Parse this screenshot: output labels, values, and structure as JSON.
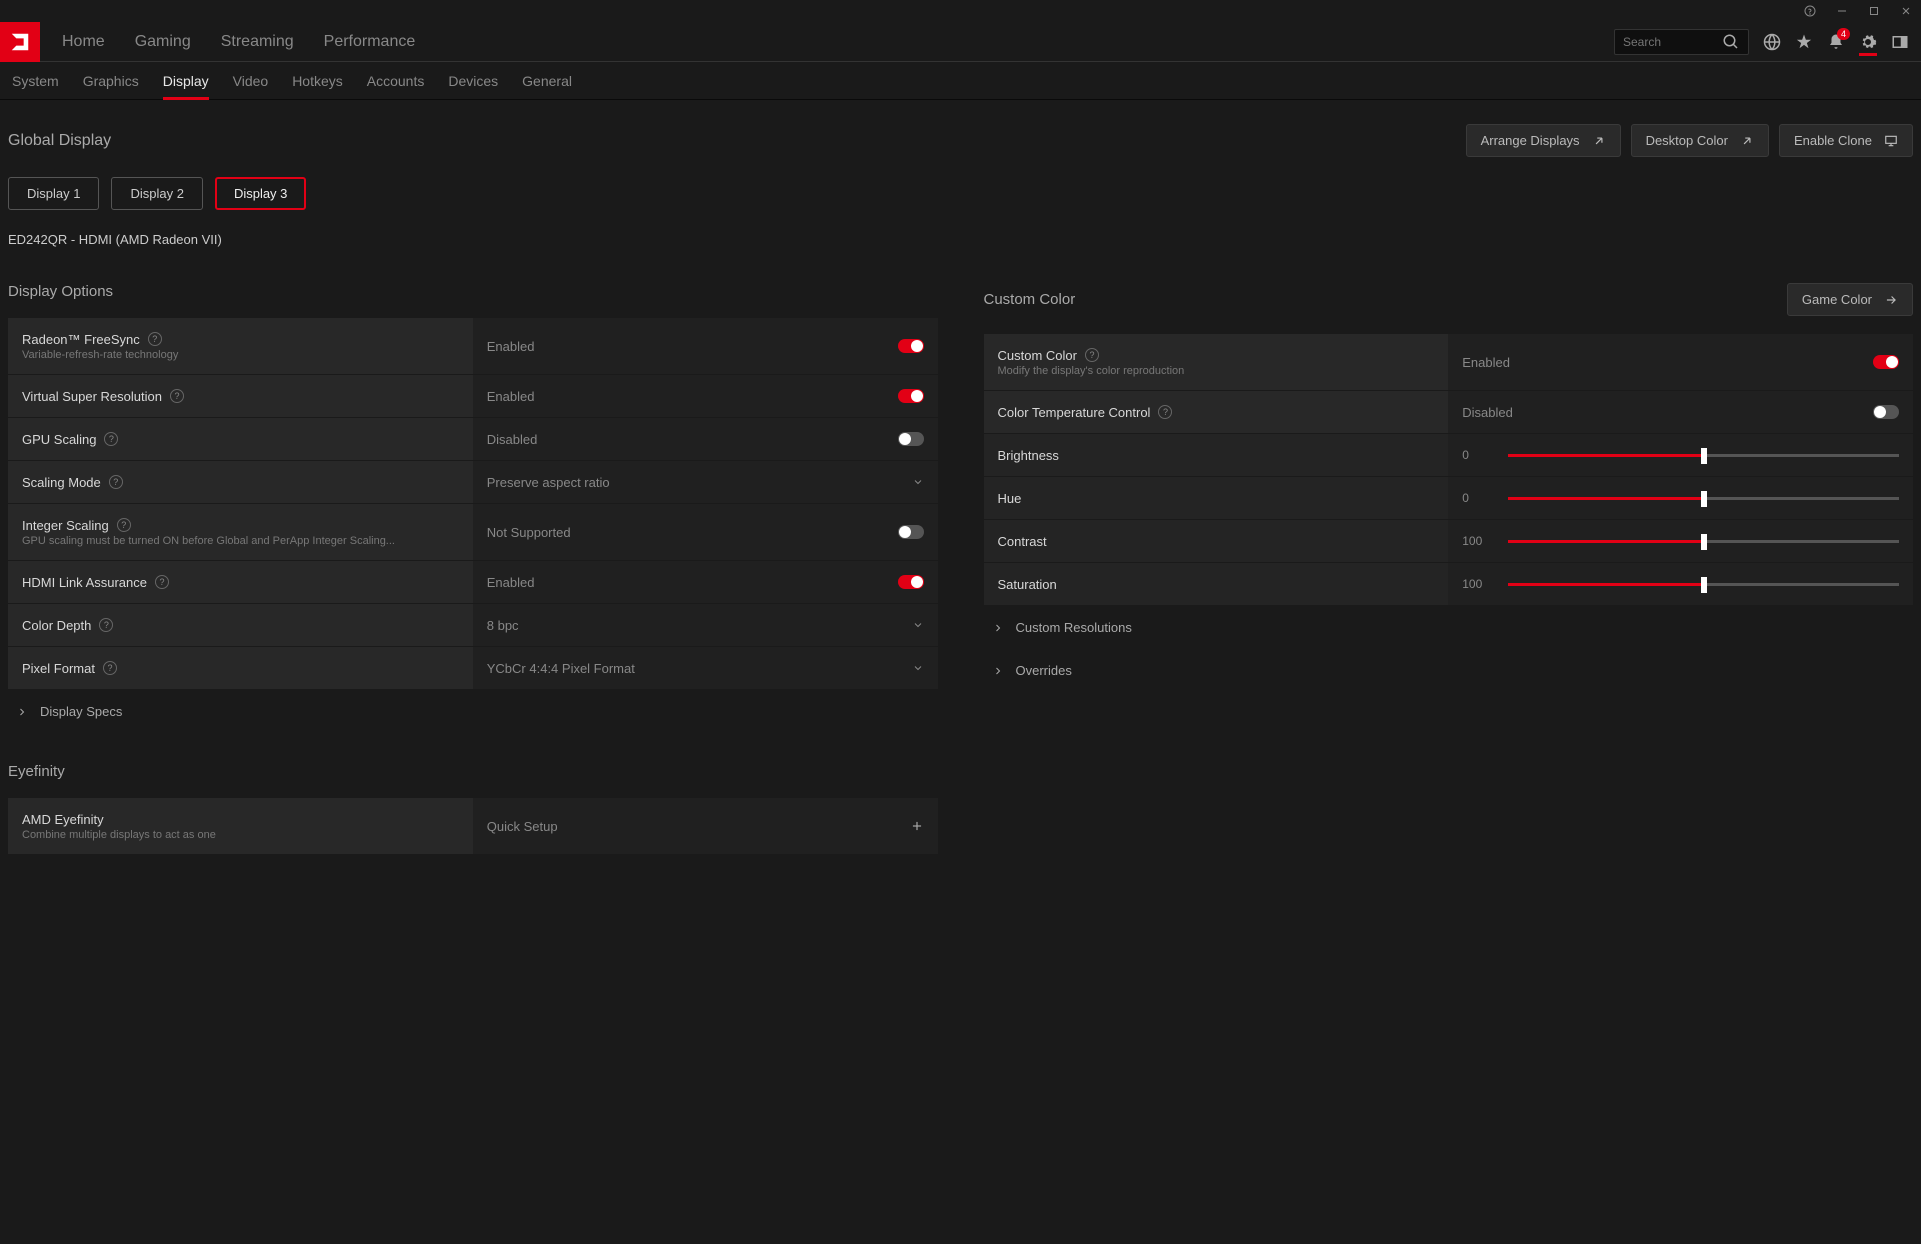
{
  "titlebar": {
    "help": "?",
    "min": "−",
    "max": "□",
    "close": "✕"
  },
  "mainnav": {
    "tabs": [
      "Home",
      "Gaming",
      "Streaming",
      "Performance"
    ],
    "search_placeholder": "Search",
    "notification_count": "4"
  },
  "subnav": {
    "tabs": [
      "System",
      "Graphics",
      "Display",
      "Video",
      "Hotkeys",
      "Accounts",
      "Devices",
      "General"
    ],
    "active": 2
  },
  "page": {
    "title": "Global Display",
    "actions": {
      "arrange": "Arrange Displays",
      "desktop_color": "Desktop Color",
      "enable_clone": "Enable Clone"
    },
    "display_tabs": [
      "Display 1",
      "Display 2",
      "Display 3"
    ],
    "display_active": 2,
    "display_info": "ED242QR - HDMI (AMD Radeon VII)"
  },
  "display_options": {
    "title": "Display Options",
    "freesync": {
      "name": "Radeon™ FreeSync",
      "sub": "Variable-refresh-rate technology",
      "value": "Enabled",
      "on": true
    },
    "vsr": {
      "name": "Virtual Super Resolution",
      "value": "Enabled",
      "on": true
    },
    "gpu_scaling": {
      "name": "GPU Scaling",
      "value": "Disabled",
      "on": false
    },
    "scaling_mode": {
      "name": "Scaling Mode",
      "value": "Preserve aspect ratio"
    },
    "integer_scaling": {
      "name": "Integer Scaling",
      "sub": "GPU scaling must be turned ON before Global and PerApp Integer Scaling...",
      "value": "Not Supported",
      "on": false
    },
    "hdmi_link": {
      "name": "HDMI Link Assurance",
      "value": "Enabled",
      "on": true
    },
    "color_depth": {
      "name": "Color Depth",
      "value": "8 bpc"
    },
    "pixel_format": {
      "name": "Pixel Format",
      "value": "YCbCr 4:4:4 Pixel Format"
    },
    "display_specs": "Display Specs"
  },
  "eyefinity": {
    "title": "Eyefinity",
    "name": "AMD Eyefinity",
    "sub": "Combine multiple displays to act as one",
    "value": "Quick Setup"
  },
  "custom_color": {
    "title": "Custom Color",
    "game_color_btn": "Game Color",
    "custom": {
      "name": "Custom Color",
      "sub": "Modify the display's color reproduction",
      "value": "Enabled",
      "on": true
    },
    "temp": {
      "name": "Color Temperature Control",
      "value": "Disabled",
      "on": false
    },
    "brightness": {
      "name": "Brightness",
      "value": "0",
      "pct": 50
    },
    "hue": {
      "name": "Hue",
      "value": "0",
      "pct": 50
    },
    "contrast": {
      "name": "Contrast",
      "value": "100",
      "pct": 50
    },
    "saturation": {
      "name": "Saturation",
      "value": "100",
      "pct": 50
    },
    "custom_res": "Custom Resolutions",
    "overrides": "Overrides"
  }
}
